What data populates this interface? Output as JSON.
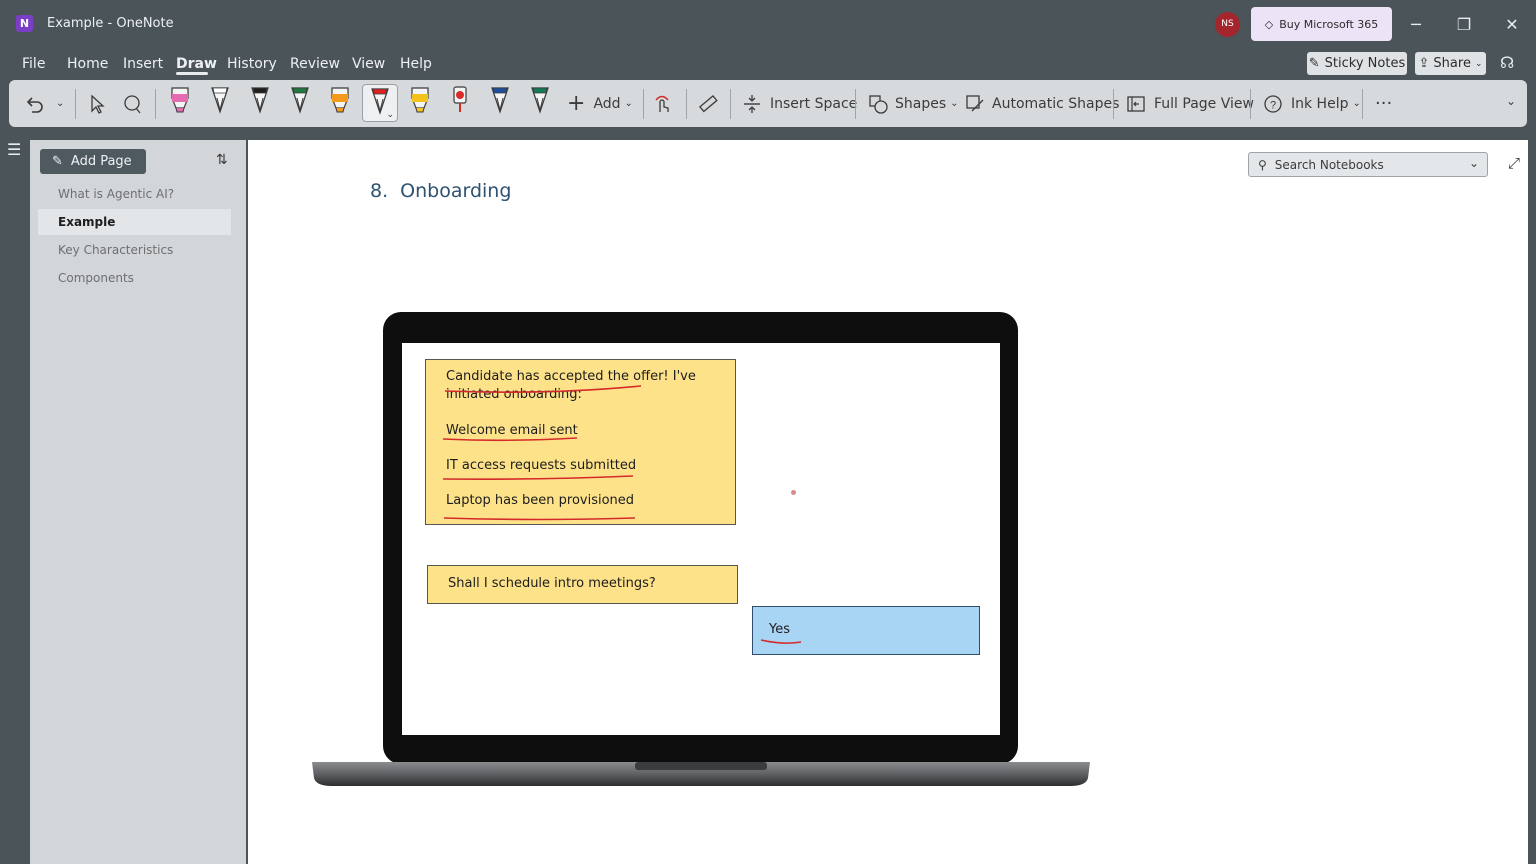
{
  "window": {
    "title": "Example  -  OneNote",
    "logo_letter": "N",
    "avatar_initials": "NS",
    "buy_label": "Buy Microsoft 365",
    "controls": {
      "minimize": "─",
      "restore": "❐",
      "close": "✕"
    }
  },
  "menu": {
    "items": [
      "File",
      "Home",
      "Insert",
      "Draw",
      "History",
      "Review",
      "View",
      "Help"
    ],
    "active": "Draw",
    "sticky_notes_label": "Sticky Notes",
    "share_label": "Share"
  },
  "ribbon": {
    "tools": [
      "undo-icon",
      "lasso-select-icon",
      "eraser-icon"
    ],
    "pens": [
      {
        "name": "pink-highlighter",
        "color": "#e56bb0"
      },
      {
        "name": "white-pen",
        "color": "#ffffff"
      },
      {
        "name": "black-pen",
        "color": "#1e1e1e"
      },
      {
        "name": "green-pen",
        "color": "#1f7a3e"
      },
      {
        "name": "orange-highlighter",
        "color": "#f59a1a"
      },
      {
        "name": "red-pen",
        "color": "#e02020"
      },
      {
        "name": "yellow-highlighter",
        "color": "#f3c21d"
      },
      {
        "name": "red-marker",
        "color": "#d92a2a"
      },
      {
        "name": "blue-pen",
        "color": "#1e4e9c"
      },
      {
        "name": "teal-pen",
        "color": "#157a55"
      }
    ],
    "selected_pen": "red-pen",
    "add_label": "Add",
    "insert_space_label": "Insert Space",
    "shapes_label": "Shapes",
    "automatic_shapes_label": "Automatic Shapes",
    "full_page_view_label": "Full Page View",
    "ink_help_label": "Ink Help",
    "more_label": "···"
  },
  "pages": {
    "add_page_label": "Add Page",
    "items": [
      "What is Agentic AI?",
      "Example",
      "Key Characteristics",
      "Components"
    ],
    "selected": "Example"
  },
  "canvas": {
    "search_placeholder": "Search Notebooks",
    "title_number": "8.",
    "title": "Onboarding",
    "note1": {
      "line1": "Candidate has accepted the offer! I've",
      "line2": "initiated onboarding:",
      "item1": "Welcome email sent",
      "item2": "IT access requests submitted",
      "item3": "Laptop has been provisioned"
    },
    "note2": "Shall I schedule intro meetings?",
    "reply": "Yes"
  },
  "colors": {
    "chrome": "#4b5459",
    "ribbon": "#d6dadd",
    "note_yellow": "#fde28a",
    "reply_blue": "#a9d5f5",
    "ink_red": "#d42a2a",
    "title_blue": "#2f5270"
  }
}
